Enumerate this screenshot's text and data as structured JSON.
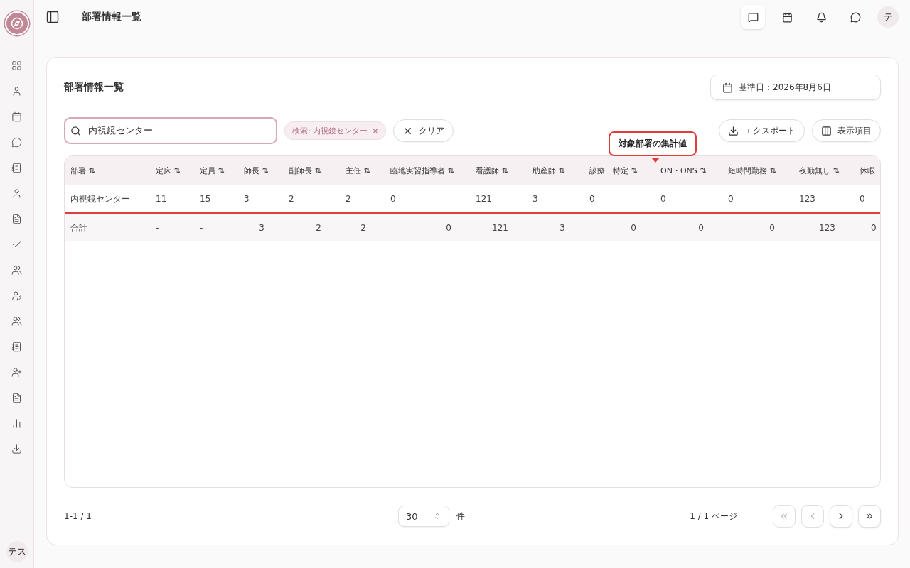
{
  "header": {
    "title": "部署情報一覧",
    "avatar": "テ"
  },
  "sidebar": {
    "avatar": "テス"
  },
  "card": {
    "title": "部署情報一覧",
    "date_button": "基準日：2026年8月6日",
    "search": {
      "value": "内視鏡センター"
    },
    "filter_chip": {
      "label": "検索: 内視鏡センター",
      "remove": "×"
    },
    "clear_button": "クリア",
    "export_button": "エクスポート",
    "columns_button": "表示項目",
    "tooltip": "対象部署の集計値",
    "table": {
      "columns": [
        {
          "label": "部署",
          "sort": "⇅"
        },
        {
          "label": "定床",
          "sort": "⇅"
        },
        {
          "label": "定員",
          "sort": "⇅"
        },
        {
          "label": "師長",
          "sort": "⇅"
        },
        {
          "label": "副師長",
          "sort": "⇅"
        },
        {
          "label": "主任",
          "sort": "⇅"
        },
        {
          "label": "臨地実習指導者",
          "sort": "⇅"
        },
        {
          "label": "看護師",
          "sort": "⇅"
        },
        {
          "label": "助産師",
          "sort": "⇅"
        },
        {
          "label": "診療　特定",
          "sort": "⇅"
        },
        {
          "label": "ON・ONS",
          "sort": "⇅"
        },
        {
          "label": "短時間勤務",
          "sort": "⇅"
        },
        {
          "label": "夜勤無し",
          "sort": "⇅"
        },
        {
          "label": "休暇"
        }
      ],
      "rows": [
        [
          "内視鏡センター",
          "11",
          "15",
          "3",
          "2",
          "2",
          "0",
          "121",
          "3",
          "0",
          "0",
          "0",
          "123",
          "0"
        ]
      ],
      "total": [
        "合計",
        "-",
        "-",
        "3",
        "2",
        "2",
        "0",
        "121",
        "3",
        "0",
        "0",
        "0",
        "123",
        "0"
      ]
    },
    "pagination": {
      "range": "1-1 / 1",
      "page_size": "30",
      "unit": "件",
      "page": "1 / 1 ページ",
      "buttons": [
        {
          "kind": "first",
          "disabled": true
        },
        {
          "kind": "prev",
          "disabled": true
        },
        {
          "kind": "next",
          "disabled": false
        },
        {
          "kind": "last",
          "disabled": false
        }
      ]
    }
  }
}
